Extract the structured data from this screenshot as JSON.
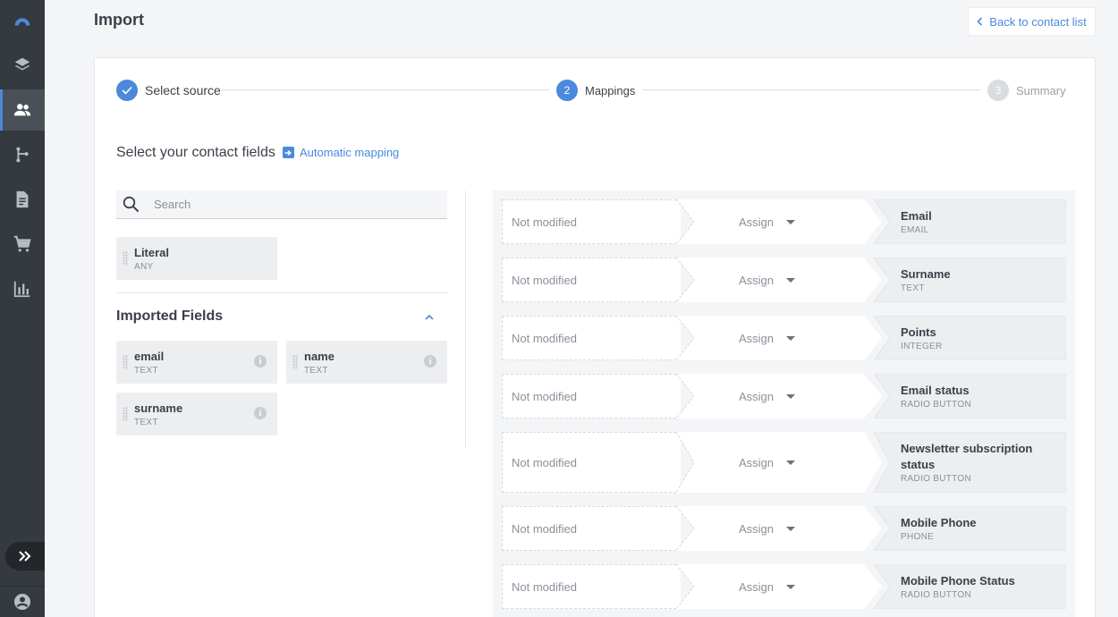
{
  "header": {
    "title": "Import",
    "back_label": "Back to contact list"
  },
  "sidebar": {
    "items": [
      {
        "icon": "logo-icon"
      },
      {
        "icon": "layers-icon"
      },
      {
        "icon": "contacts-icon",
        "active": true
      },
      {
        "icon": "workflow-icon"
      },
      {
        "icon": "document-icon"
      },
      {
        "icon": "cart-icon"
      },
      {
        "icon": "bar-chart-icon"
      }
    ]
  },
  "stepper": {
    "steps": [
      {
        "number": "",
        "label": "Select source",
        "state": "done"
      },
      {
        "number": "2",
        "label": "Mappings",
        "state": "active"
      },
      {
        "number": "3",
        "label": "Summary",
        "state": "pending"
      }
    ]
  },
  "main": {
    "section_title": "Select your contact fields",
    "automatic_mapping": "Automatic mapping",
    "search_placeholder": "Search",
    "literal": {
      "name": "Literal",
      "type": "ANY"
    },
    "imported_title": "Imported Fields",
    "imported_fields": [
      {
        "name": "email",
        "type": "TEXT"
      },
      {
        "name": "name",
        "type": "TEXT"
      },
      {
        "name": "surname",
        "type": "TEXT"
      }
    ]
  },
  "mappings": {
    "source_placeholder": "Not modified",
    "assign_label": "Assign",
    "rows": [
      {
        "target": "Email",
        "type": "EMAIL"
      },
      {
        "target": "Surname",
        "type": "TEXT"
      },
      {
        "target": "Points",
        "type": "INTEGER"
      },
      {
        "target": "Email status",
        "type": "RADIO BUTTON"
      },
      {
        "target": "Newsletter subscription status",
        "type": "RADIO BUTTON"
      },
      {
        "target": "Mobile Phone",
        "type": "PHONE"
      },
      {
        "target": "Mobile Phone Status",
        "type": "RADIO BUTTON"
      }
    ]
  },
  "colors": {
    "accent": "#4b89dc",
    "sidebar_bg": "#343a40",
    "pending_step": "#d9dce1"
  }
}
